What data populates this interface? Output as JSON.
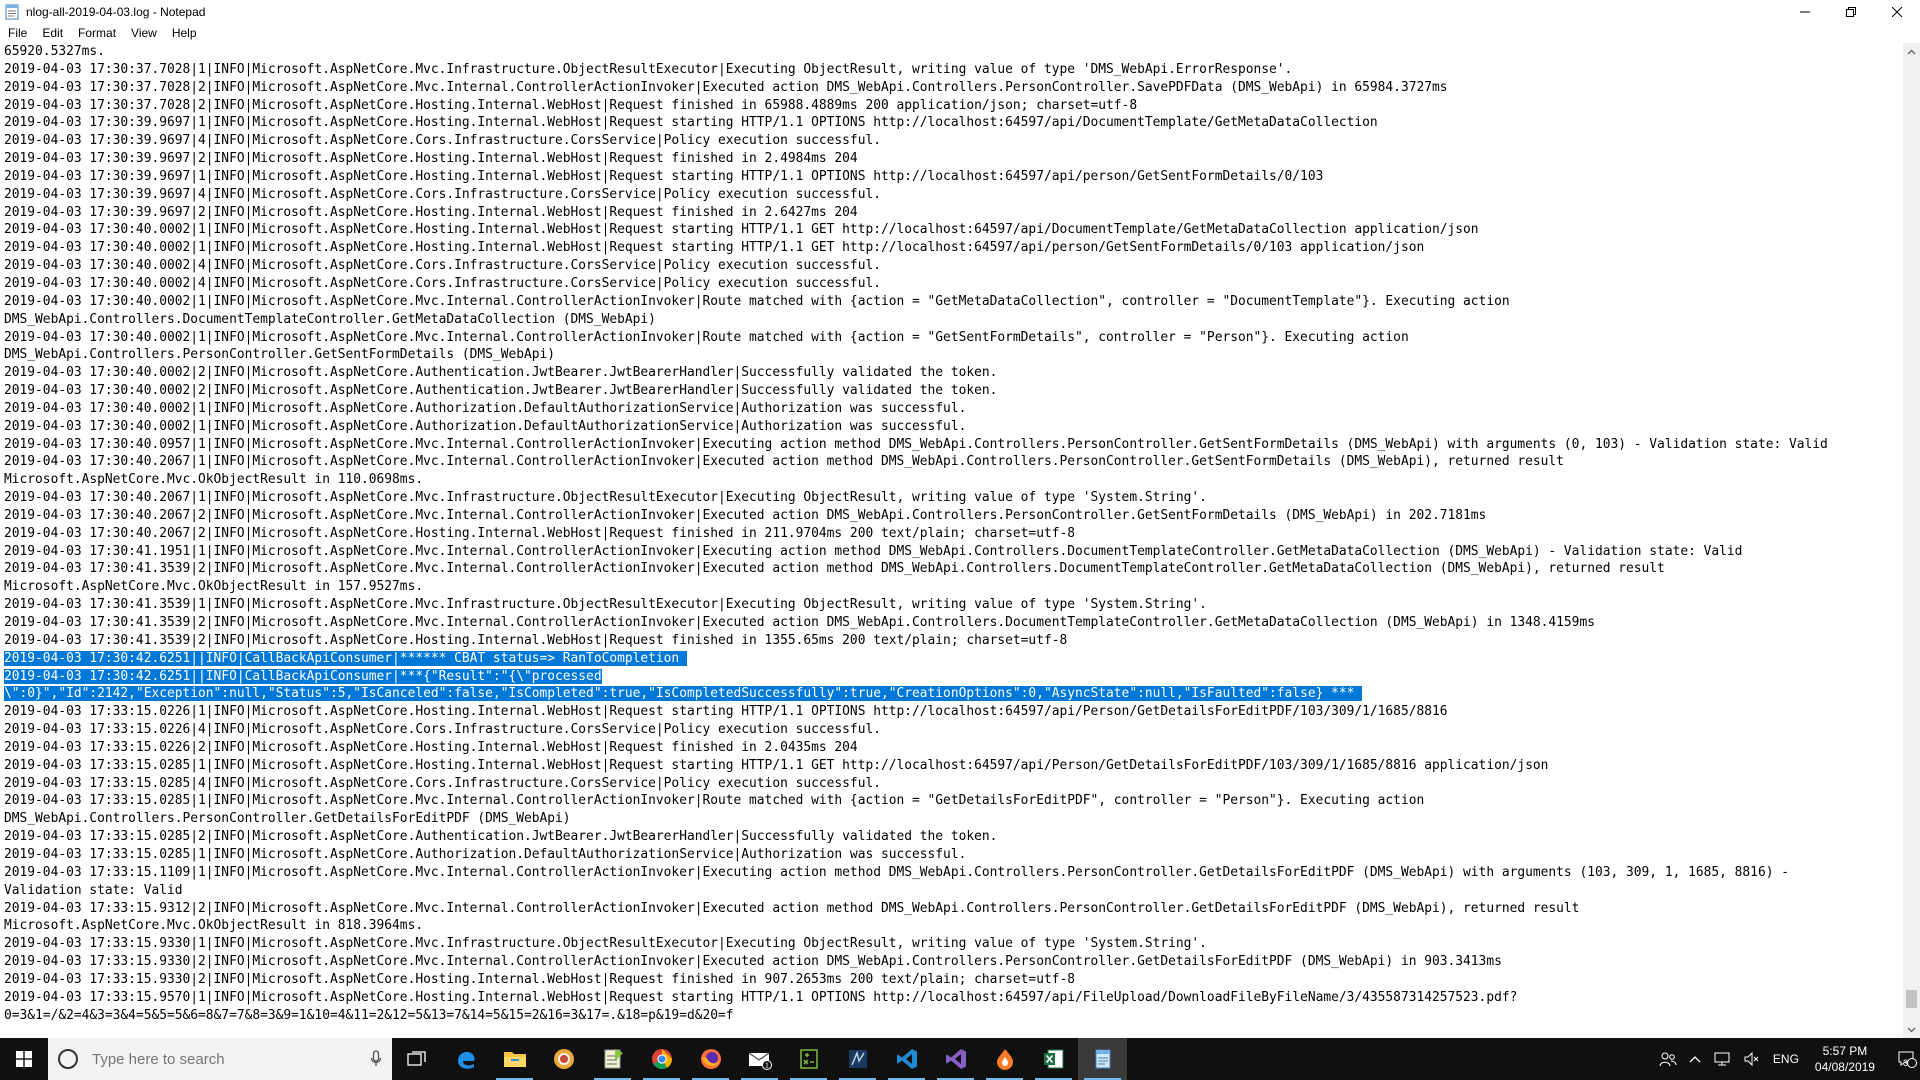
{
  "window": {
    "title": "nlog-all-2019-04-03.log - Notepad",
    "controls": [
      "minimize",
      "maximize",
      "close"
    ]
  },
  "menu": [
    "File",
    "Edit",
    "Format",
    "View",
    "Help"
  ],
  "log_lines": [
    "65920.5327ms.",
    "2019-04-03 17:30:37.7028|1|INFO|Microsoft.AspNetCore.Mvc.Infrastructure.ObjectResultExecutor|Executing ObjectResult, writing value of type 'DMS_WebApi.ErrorResponse'.",
    "2019-04-03 17:30:37.7028|2|INFO|Microsoft.AspNetCore.Mvc.Internal.ControllerActionInvoker|Executed action DMS_WebApi.Controllers.PersonController.SavePDFData (DMS_WebApi) in 65984.3727ms",
    "2019-04-03 17:30:37.7028|2|INFO|Microsoft.AspNetCore.Hosting.Internal.WebHost|Request finished in 65988.4889ms 200 application/json; charset=utf-8",
    "2019-04-03 17:30:39.9697|1|INFO|Microsoft.AspNetCore.Hosting.Internal.WebHost|Request starting HTTP/1.1 OPTIONS http://localhost:64597/api/DocumentTemplate/GetMetaDataCollection",
    "2019-04-03 17:30:39.9697|4|INFO|Microsoft.AspNetCore.Cors.Infrastructure.CorsService|Policy execution successful.",
    "2019-04-03 17:30:39.9697|2|INFO|Microsoft.AspNetCore.Hosting.Internal.WebHost|Request finished in 2.4984ms 204",
    "2019-04-03 17:30:39.9697|1|INFO|Microsoft.AspNetCore.Hosting.Internal.WebHost|Request starting HTTP/1.1 OPTIONS http://localhost:64597/api/person/GetSentFormDetails/0/103",
    "2019-04-03 17:30:39.9697|4|INFO|Microsoft.AspNetCore.Cors.Infrastructure.CorsService|Policy execution successful.",
    "2019-04-03 17:30:39.9697|2|INFO|Microsoft.AspNetCore.Hosting.Internal.WebHost|Request finished in 2.6427ms 204",
    "2019-04-03 17:30:40.0002|1|INFO|Microsoft.AspNetCore.Hosting.Internal.WebHost|Request starting HTTP/1.1 GET http://localhost:64597/api/DocumentTemplate/GetMetaDataCollection application/json",
    "2019-04-03 17:30:40.0002|1|INFO|Microsoft.AspNetCore.Hosting.Internal.WebHost|Request starting HTTP/1.1 GET http://localhost:64597/api/person/GetSentFormDetails/0/103 application/json",
    "2019-04-03 17:30:40.0002|4|INFO|Microsoft.AspNetCore.Cors.Infrastructure.CorsService|Policy execution successful.",
    "2019-04-03 17:30:40.0002|4|INFO|Microsoft.AspNetCore.Cors.Infrastructure.CorsService|Policy execution successful.",
    "2019-04-03 17:30:40.0002|1|INFO|Microsoft.AspNetCore.Mvc.Internal.ControllerActionInvoker|Route matched with {action = \"GetMetaDataCollection\", controller = \"DocumentTemplate\"}. Executing action",
    "DMS_WebApi.Controllers.DocumentTemplateController.GetMetaDataCollection (DMS_WebApi)",
    "2019-04-03 17:30:40.0002|1|INFO|Microsoft.AspNetCore.Mvc.Internal.ControllerActionInvoker|Route matched with {action = \"GetSentFormDetails\", controller = \"Person\"}. Executing action",
    "DMS_WebApi.Controllers.PersonController.GetSentFormDetails (DMS_WebApi)",
    "2019-04-03 17:30:40.0002|2|INFO|Microsoft.AspNetCore.Authentication.JwtBearer.JwtBearerHandler|Successfully validated the token.",
    "2019-04-03 17:30:40.0002|2|INFO|Microsoft.AspNetCore.Authentication.JwtBearer.JwtBearerHandler|Successfully validated the token.",
    "2019-04-03 17:30:40.0002|1|INFO|Microsoft.AspNetCore.Authorization.DefaultAuthorizationService|Authorization was successful.",
    "2019-04-03 17:30:40.0002|1|INFO|Microsoft.AspNetCore.Authorization.DefaultAuthorizationService|Authorization was successful.",
    "2019-04-03 17:30:40.0957|1|INFO|Microsoft.AspNetCore.Mvc.Internal.ControllerActionInvoker|Executing action method DMS_WebApi.Controllers.PersonController.GetSentFormDetails (DMS_WebApi) with arguments (0, 103) - Validation state: Valid",
    "2019-04-03 17:30:40.2067|1|INFO|Microsoft.AspNetCore.Mvc.Internal.ControllerActionInvoker|Executed action method DMS_WebApi.Controllers.PersonController.GetSentFormDetails (DMS_WebApi), returned result",
    "Microsoft.AspNetCore.Mvc.OkObjectResult in 110.0698ms.",
    "2019-04-03 17:30:40.2067|1|INFO|Microsoft.AspNetCore.Mvc.Infrastructure.ObjectResultExecutor|Executing ObjectResult, writing value of type 'System.String'.",
    "2019-04-03 17:30:40.2067|2|INFO|Microsoft.AspNetCore.Mvc.Internal.ControllerActionInvoker|Executed action DMS_WebApi.Controllers.PersonController.GetSentFormDetails (DMS_WebApi) in 202.7181ms",
    "2019-04-03 17:30:40.2067|2|INFO|Microsoft.AspNetCore.Hosting.Internal.WebHost|Request finished in 211.9704ms 200 text/plain; charset=utf-8",
    "2019-04-03 17:30:41.1951|1|INFO|Microsoft.AspNetCore.Mvc.Internal.ControllerActionInvoker|Executing action method DMS_WebApi.Controllers.DocumentTemplateController.GetMetaDataCollection (DMS_WebApi) - Validation state: Valid",
    "2019-04-03 17:30:41.3539|2|INFO|Microsoft.AspNetCore.Mvc.Internal.ControllerActionInvoker|Executed action method DMS_WebApi.Controllers.DocumentTemplateController.GetMetaDataCollection (DMS_WebApi), returned result",
    "Microsoft.AspNetCore.Mvc.OkObjectResult in 157.9527ms.",
    "2019-04-03 17:30:41.3539|1|INFO|Microsoft.AspNetCore.Mvc.Infrastructure.ObjectResultExecutor|Executing ObjectResult, writing value of type 'System.String'.",
    "2019-04-03 17:30:41.3539|2|INFO|Microsoft.AspNetCore.Mvc.Internal.ControllerActionInvoker|Executed action DMS_WebApi.Controllers.DocumentTemplateController.GetMetaDataCollection (DMS_WebApi) in 1348.4159ms",
    "2019-04-03 17:30:41.3539|2|INFO|Microsoft.AspNetCore.Hosting.Internal.WebHost|Request finished in 1355.65ms 200 text/plain; charset=utf-8",
    "2019-04-03 17:30:42.6251||INFO|CallBackApiConsumer|****** CBAT status=> RanToCompletion ",
    "2019-04-03 17:30:42.6251||INFO|CallBackApiConsumer|***{\"Result\":\"{\\\"processed",
    "\\\":0}\",\"Id\":2142,\"Exception\":null,\"Status\":5,\"IsCanceled\":false,\"IsCompleted\":true,\"IsCompletedSuccessfully\":true,\"CreationOptions\":0,\"AsyncState\":null,\"IsFaulted\":false} *** ",
    "2019-04-03 17:33:15.0226|1|INFO|Microsoft.AspNetCore.Hosting.Internal.WebHost|Request starting HTTP/1.1 OPTIONS http://localhost:64597/api/Person/GetDetailsForEditPDF/103/309/1/1685/8816",
    "2019-04-03 17:33:15.0226|4|INFO|Microsoft.AspNetCore.Cors.Infrastructure.CorsService|Policy execution successful.",
    "2019-04-03 17:33:15.0226|2|INFO|Microsoft.AspNetCore.Hosting.Internal.WebHost|Request finished in 2.0435ms 204",
    "2019-04-03 17:33:15.0285|1|INFO|Microsoft.AspNetCore.Hosting.Internal.WebHost|Request starting HTTP/1.1 GET http://localhost:64597/api/Person/GetDetailsForEditPDF/103/309/1/1685/8816 application/json",
    "2019-04-03 17:33:15.0285|4|INFO|Microsoft.AspNetCore.Cors.Infrastructure.CorsService|Policy execution successful.",
    "2019-04-03 17:33:15.0285|1|INFO|Microsoft.AspNetCore.Mvc.Internal.ControllerActionInvoker|Route matched with {action = \"GetDetailsForEditPDF\", controller = \"Person\"}. Executing action",
    "DMS_WebApi.Controllers.PersonController.GetDetailsForEditPDF (DMS_WebApi)",
    "2019-04-03 17:33:15.0285|2|INFO|Microsoft.AspNetCore.Authentication.JwtBearer.JwtBearerHandler|Successfully validated the token.",
    "2019-04-03 17:33:15.0285|1|INFO|Microsoft.AspNetCore.Authorization.DefaultAuthorizationService|Authorization was successful.",
    "2019-04-03 17:33:15.1109|1|INFO|Microsoft.AspNetCore.Mvc.Internal.ControllerActionInvoker|Executing action method DMS_WebApi.Controllers.PersonController.GetDetailsForEditPDF (DMS_WebApi) with arguments (103, 309, 1, 1685, 8816) -",
    "Validation state: Valid",
    "2019-04-03 17:33:15.9312|2|INFO|Microsoft.AspNetCore.Mvc.Internal.ControllerActionInvoker|Executed action method DMS_WebApi.Controllers.PersonController.GetDetailsForEditPDF (DMS_WebApi), returned result",
    "Microsoft.AspNetCore.Mvc.OkObjectResult in 818.3964ms.",
    "2019-04-03 17:33:15.9330|1|INFO|Microsoft.AspNetCore.Mvc.Infrastructure.ObjectResultExecutor|Executing ObjectResult, writing value of type 'System.String'.",
    "2019-04-03 17:33:15.9330|2|INFO|Microsoft.AspNetCore.Mvc.Internal.ControllerActionInvoker|Executed action DMS_WebApi.Controllers.PersonController.GetDetailsForEditPDF (DMS_WebApi) in 903.3413ms",
    "2019-04-03 17:33:15.9330|2|INFO|Microsoft.AspNetCore.Hosting.Internal.WebHost|Request finished in 907.2653ms 200 text/plain; charset=utf-8",
    "2019-04-03 17:33:15.9570|1|INFO|Microsoft.AspNetCore.Hosting.Internal.WebHost|Request starting HTTP/1.1 OPTIONS http://localhost:64597/api/FileUpload/DownloadFileByFileName/3/435587314257523.pdf?",
    "0=3&1=/&2=4&3=3&4=5&5=5&6=8&7=7&8=3&9=1&10=4&11=2&12=5&13=7&14=5&15=2&16=3&17=.&18=p&19=d&20=f"
  ],
  "selected_line_indices": [
    34,
    35,
    36
  ],
  "taskbar": {
    "search_placeholder": "Type here to search",
    "apps": [
      {
        "icon": "task-view-icon"
      },
      {
        "icon": "edge-icon"
      },
      {
        "icon": "file-explorer-icon",
        "open": true
      },
      {
        "icon": "chrome-canary-icon"
      },
      {
        "icon": "notepadpp-icon",
        "open": true
      },
      {
        "icon": "chrome-icon",
        "open": true
      },
      {
        "icon": "firefox-icon",
        "open": true
      },
      {
        "icon": "mail-icon",
        "open": true
      },
      {
        "icon": "calculator-icon",
        "open": true
      },
      {
        "icon": "ssms-icon",
        "open": true
      },
      {
        "icon": "vscode-icon",
        "open": true
      },
      {
        "icon": "visual-studio-icon",
        "open": true
      },
      {
        "icon": "xampp-icon",
        "open": true
      },
      {
        "icon": "excel-icon",
        "open": true
      },
      {
        "icon": "notepad-icon",
        "open": true,
        "active": true
      }
    ],
    "language": "ENG",
    "time": "5:57 PM",
    "date": "04/08/2019",
    "notification_count": "3"
  },
  "colors": {
    "selection": "#0078d7",
    "taskbar": "#101010"
  }
}
